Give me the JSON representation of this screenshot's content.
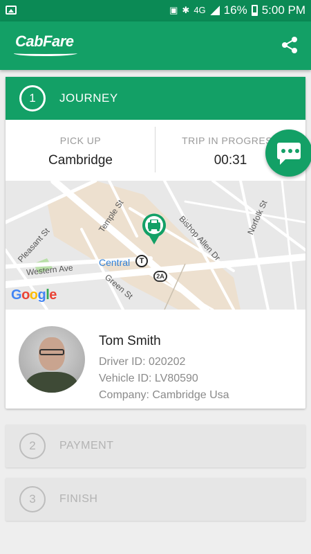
{
  "status_bar": {
    "network": "4G",
    "battery": "16%",
    "time": "5:00 PM",
    "icons": [
      "image-icon",
      "sim-icon",
      "bluetooth-icon",
      "signal-icon",
      "battery-icon"
    ]
  },
  "app_bar": {
    "title": "CabFare",
    "share_icon": "share-icon"
  },
  "colors": {
    "primary": "#13a066",
    "primary_dark": "#0b8a55",
    "inactive": "#b3b3b3"
  },
  "journey": {
    "step_number": "1",
    "title": "JOURNEY",
    "pickup_label": "PICK UP",
    "pickup_value": "Cambridge",
    "trip_label": "TRIP IN PROGRESS",
    "trip_value": "00:31",
    "chat_icon": "chat-icon"
  },
  "map": {
    "streets": [
      "Temple St",
      "Bishop Allen Dr",
      "Norfolk St",
      "Pleasant St",
      "Western Ave",
      "Green St"
    ],
    "place": "Central",
    "route_shield": "2A",
    "transit_icon": "T",
    "provider": "Google"
  },
  "driver": {
    "name": "Tom Smith",
    "driver_id": "Driver ID: 020202",
    "vehicle_id": "Vehicle ID: LV80590",
    "company": "Company: Cambridge Usa"
  },
  "steps": [
    {
      "number": "2",
      "title": "PAYMENT"
    },
    {
      "number": "3",
      "title": "FINISH"
    }
  ]
}
